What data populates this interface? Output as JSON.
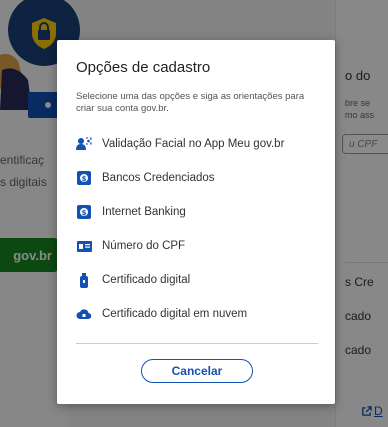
{
  "background": {
    "left_texts": [
      "entificaç",
      "s digitais"
    ],
    "govbr_button": "gov.br",
    "right_title": "o do",
    "right_sub_lines": [
      "bre se",
      "mo ass"
    ],
    "right_input_placeholder": "u CPF",
    "right_items": [
      "s Cre",
      "cado",
      "cado"
    ],
    "right_link": "D"
  },
  "modal": {
    "title": "Opções de cadastro",
    "description": "Selecione uma das opções e siga as orientações para criar sua conta gov.br.",
    "options": [
      {
        "label": "Validação Facial no App Meu gov.br",
        "icon": "face-id-icon"
      },
      {
        "label": "Bancos Credenciados",
        "icon": "bank-icon"
      },
      {
        "label": "Internet Banking",
        "icon": "bank-icon"
      },
      {
        "label": "Número do CPF",
        "icon": "id-card-icon"
      },
      {
        "label": "Certificado digital",
        "icon": "usb-token-icon"
      },
      {
        "label": "Certificado digital em nuvem",
        "icon": "cloud-icon"
      }
    ],
    "cancel_label": "Cancelar"
  },
  "colors": {
    "primary": "#1351b4",
    "govbr_green": "#168821",
    "illustration_blue": "#1a3f7a"
  }
}
